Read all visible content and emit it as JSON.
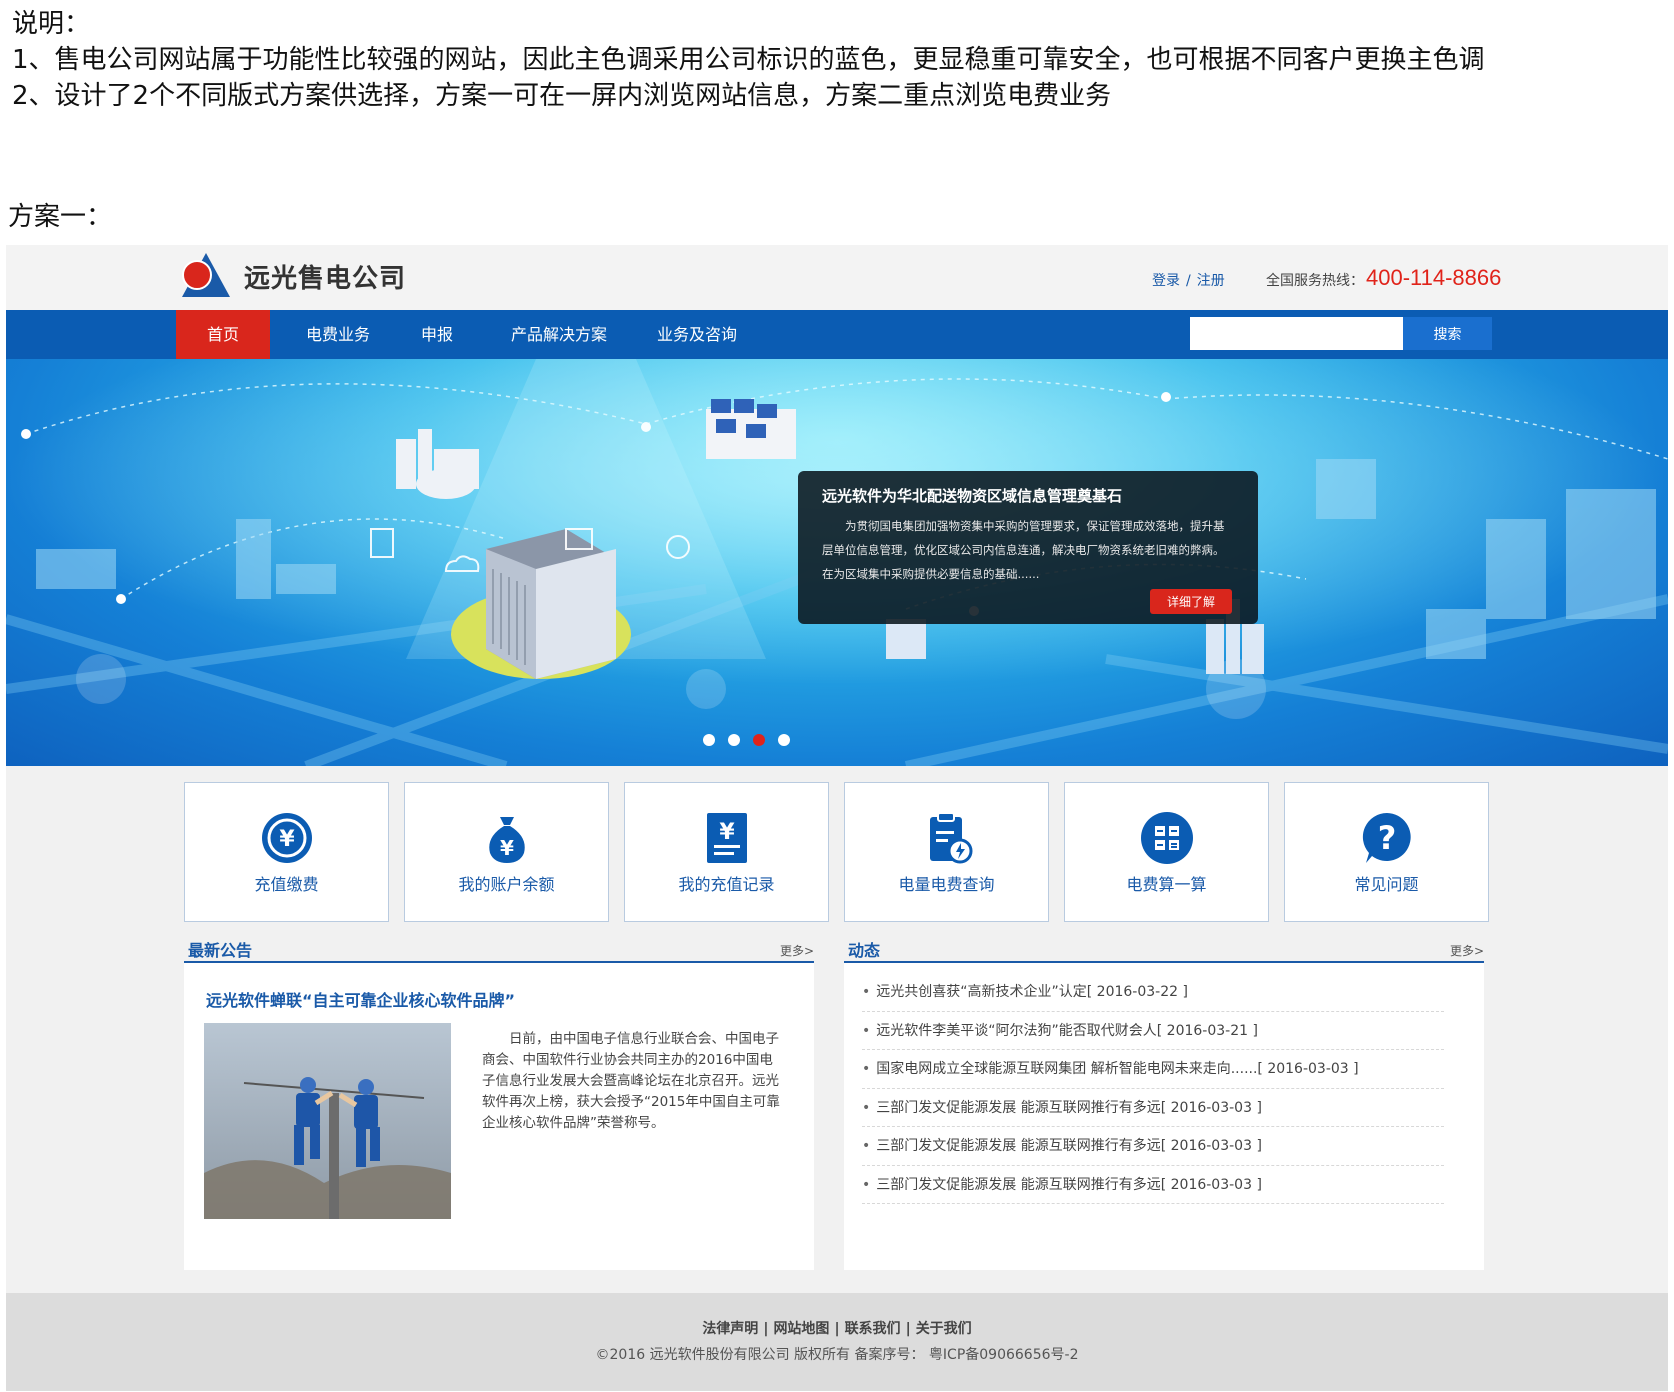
{
  "notes": {
    "heading": "说明：",
    "line1": "1、售电公司网站属于功能性比较强的网站，因此主色调采用公司标识的蓝色，更显稳重可靠安全，也可根据不同客户更换主色调",
    "line2": "2、设计了2个不同版式方案供选择，方案一可在一屏内浏览网站信息，方案二重点浏览电费业务"
  },
  "scheme_label": "方案一：",
  "header": {
    "logo_text": "远光售电公司",
    "login": "登录",
    "separator": "/",
    "register": "注册",
    "hotline_label": "全国服务热线：",
    "hotline_number": "400-114-8866"
  },
  "nav": {
    "items": [
      "首页",
      "电费业务",
      "申报",
      "产品解决方案",
      "业务及咨询"
    ],
    "active_index": 0,
    "search_placeholder": "",
    "search_button": "搜索"
  },
  "banner": {
    "news_title": "远光软件为华北配送物资区域信息管理奠基石",
    "news_body": "为贯彻国电集团加强物资集中采购的管理要求，保证管理成效落地，提升基层单位信息管理，优化区域公司内信息连通，解决电厂物资系统老旧难的弊病。在为区域集中采购提供必要信息的基础......",
    "more_button": "详细了解",
    "slide_count": 4,
    "active_slide": 2
  },
  "services": [
    {
      "label": "充值缴费",
      "icon": "yen-coin-icon"
    },
    {
      "label": "我的账户余额",
      "icon": "money-bag-icon"
    },
    {
      "label": "我的充值记录",
      "icon": "receipt-icon"
    },
    {
      "label": "电量电费查询",
      "icon": "clipboard-lightning-icon"
    },
    {
      "label": "电费算一算",
      "icon": "calculator-icon"
    },
    {
      "label": "常见问题",
      "icon": "question-icon"
    }
  ],
  "announcement": {
    "title": "最新公告",
    "more": "更多>",
    "headline": "远光软件蝉联“自主可靠企业核心软件品牌”",
    "body": "日前，由中国电子信息行业联合会、中国电子商会、中国软件行业协会共同主办的2016中国电子信息行业发展大会暨高峰论坛在北京召开。远光软件再次上榜，获大会授予“2015年中国自主可靠企业核心软件品牌”荣誉称号。"
  },
  "dynamics": {
    "title": "动态",
    "more": "更多>",
    "items": [
      "远光共创喜获“高新技术企业”认定[ 2016-03-22 ]",
      "远光软件李美平谈“阿尔法狗”能否取代财会人[ 2016-03-21 ]",
      "国家电网成立全球能源互联网集团 解析智能电网未来走向......[ 2016-03-03 ]",
      "三部门发文促能源发展 能源互联网推行有多远[ 2016-03-03 ]",
      "三部门发文促能源发展 能源互联网推行有多远[ 2016-03-03 ]",
      "三部门发文促能源发展 能源互联网推行有多远[ 2016-03-03 ]"
    ]
  },
  "footer": {
    "links": [
      "法律声明",
      "网站地图",
      "联系我们",
      "关于我们"
    ],
    "copyright": "©2016 远光软件股份有限公司 版权所有 备案序号： 粤ICP备09066656号-2"
  },
  "colors": {
    "brand_blue": "#0b5cb3",
    "accent_red": "#d9261c",
    "link_blue": "#1a5aa8"
  }
}
